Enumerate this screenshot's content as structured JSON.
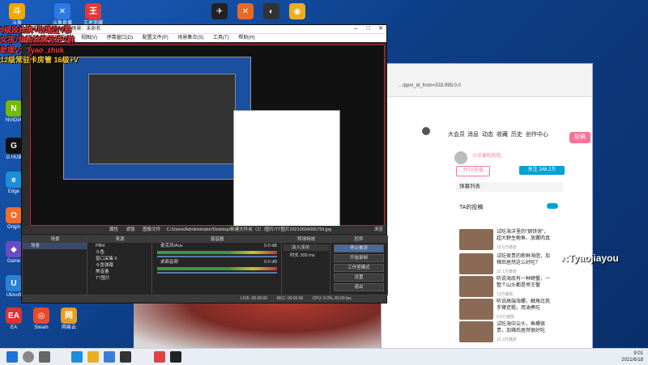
{
  "overlay": {
    "line1": "9级段丝牌+助理拉V群",
    "line2": "女孩7级粉丝牌可进V群",
    "line3": "助理V：Tyao_zhuk",
    "line4": "12级常驻卡房管 16级+V"
  },
  "watermark": ":Tyaojiayou",
  "obs": {
    "title": "配置文件：未命名 · 场景：未命名",
    "menu": [
      "文件(F)",
      "编辑(E)",
      "视图(V)",
      "停靠窗口(D)",
      "配置文件(P)",
      "场景集合(S)",
      "工具(T)",
      "帮助(H)"
    ],
    "ctrl": {
      "props": "属性",
      "filters": "滤镜",
      "image_file_label": "图像文件",
      "image_path": "C:/Users/Administrator/Desktop/新建文件夹（2）/图片/TT图片20210604095759.jpg",
      "browse": "浏览"
    },
    "docks": {
      "scenes": "场景",
      "sources": "来源",
      "mixer": "混音器",
      "transitions": "转场特效",
      "controls": "控件"
    },
    "scene_items": [
      "场景"
    ],
    "source_items": [
      "PBH",
      "斗鱼",
      "窗口采集 6",
      "斗鱼弹幕",
      "美音量",
      "TT图片"
    ],
    "mixer": [
      {
        "name": "麦克风/Aux",
        "db": "0.0 dB"
      },
      {
        "name": "桌面音频",
        "db": "0.0 dB"
      }
    ],
    "transition": {
      "type": "淡入淡出",
      "duration_label": "时长",
      "duration": "300 ms"
    },
    "controls": [
      "停止推流",
      "开始录制",
      "工作室模式",
      "设置",
      "退出"
    ],
    "status": {
      "live": "LIVE: 00:00:00",
      "rec": "REC: 00:00:00",
      "cpu": "CPU: 0.0%, 60.00 fps"
    }
  },
  "browser": {
    "url": "…/ppm_id_from=333.999.0.0",
    "nav": [
      "大会员",
      "消息",
      "动态",
      "收藏",
      "历史",
      "创作中心"
    ],
    "submit": "投稿",
    "user": {
      "name": "小兰爱吃吃吃",
      "follow": "关注 248.2万",
      "charge": "为TA充电"
    },
    "section": "弹幕列表",
    "uploader_tab": "TA的投稿",
    "videos": [
      {
        "t": "试吃海洋里的\"钢铁侠\"，超大野生鲍鱼、放螺肉真",
        "m": "18.5万播放"
      },
      {
        "t": "试吃很贵的新鲜海胆，加辣后居然这么好吃？",
        "m": "22.1万播放"
      },
      {
        "t": "听说海底有一种螃蟹，一整个山头都是帝王蟹",
        "m": "13万播放"
      },
      {
        "t": "听说高端海螺，触角比我手臂还粗，用油煮吃",
        "m": "9.9万播放"
      },
      {
        "t": "试吃海中尖头，鱼鳔很贵，加辣后居然很好吃",
        "m": "15.3万播放"
      },
      {
        "t": "试吃价格贵的海钓鱼龙虾，好吃",
        "m": "8.7万播放"
      }
    ]
  },
  "desktop_icons": [
    "斗鱼",
    "斗鱼直播",
    "王者荣耀",
    "NVIDIA",
    "G HUB",
    "Edge",
    "Origin",
    "Game",
    "Ubisoft",
    "EA",
    "Steam",
    "网易云"
  ],
  "clock": {
    "time": "9:01",
    "date": "2021/6/18"
  }
}
